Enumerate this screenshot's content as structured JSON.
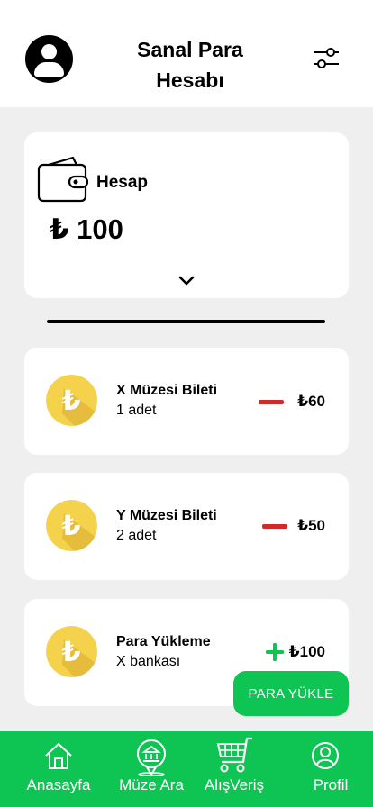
{
  "header": {
    "title_line1": "Sanal Para",
    "title_line2": "Hesabı"
  },
  "account": {
    "label": "Hesap",
    "balance": "₺ 100"
  },
  "transactions": [
    {
      "title": "X Müzesi Bileti",
      "subtitle": "1 adet",
      "type": "debit",
      "amount": "₺60"
    },
    {
      "title": "Y Müzesi Bileti",
      "subtitle": "2 adet",
      "type": "debit",
      "amount": "₺50"
    },
    {
      "title": "Para Yükleme",
      "subtitle": "X bankası",
      "type": "credit",
      "amount": "₺100"
    }
  ],
  "actions": {
    "top_up_label": "PARA YÜKLE"
  },
  "nav": [
    {
      "label": "Anasayfa",
      "icon": "home-icon"
    },
    {
      "label": "Müze Ara",
      "icon": "museum-pin-icon"
    },
    {
      "label": "AlışVeriş",
      "icon": "cart-icon"
    },
    {
      "label": "Profil",
      "icon": "profile-icon"
    }
  ],
  "colors": {
    "accent_green": "#0ec553",
    "debit_red": "#d02a2a",
    "coin_yellow": "#f5d24b",
    "background": "#efefef"
  }
}
